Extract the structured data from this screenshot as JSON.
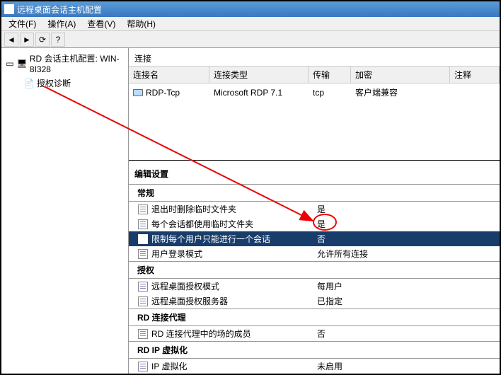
{
  "window": {
    "title": "远程桌面会话主机配置"
  },
  "menu": {
    "file": "文件(F)",
    "action": "操作(A)",
    "view": "查看(V)",
    "help": "帮助(H)"
  },
  "tree": {
    "root": "RD 会话主机配置: WIN-8I328",
    "child": "授权诊断"
  },
  "connections": {
    "label": "连接",
    "headers": {
      "name": "连接名",
      "type": "连接类型",
      "trans": "传输",
      "enc": "加密",
      "note": "注释"
    },
    "row": {
      "name": "RDP-Tcp",
      "type": "Microsoft RDP 7.1",
      "trans": "tcp",
      "enc": "客户端兼容",
      "note": ""
    }
  },
  "settings": {
    "label": "编辑设置",
    "general": {
      "header": "常规",
      "items": [
        {
          "label": "退出时删除临时文件夹",
          "value": "是"
        },
        {
          "label": "每个会话都使用临时文件夹",
          "value": "是"
        },
        {
          "label": "限制每个用户只能进行一个会话",
          "value": "否"
        },
        {
          "label": "用户登录模式",
          "value": "允许所有连接"
        }
      ]
    },
    "auth": {
      "header": "授权",
      "items": [
        {
          "label": "远程桌面授权模式",
          "value": "每用户"
        },
        {
          "label": "远程桌面授权服务器",
          "value": "已指定"
        }
      ]
    },
    "broker": {
      "header": "RD 连接代理",
      "items": [
        {
          "label": "RD 连接代理中的场的成员",
          "value": "否"
        }
      ]
    },
    "ipvirt": {
      "header": "RD IP 虚拟化",
      "items": [
        {
          "label": "IP 虚拟化",
          "value": "未启用"
        }
      ]
    }
  }
}
